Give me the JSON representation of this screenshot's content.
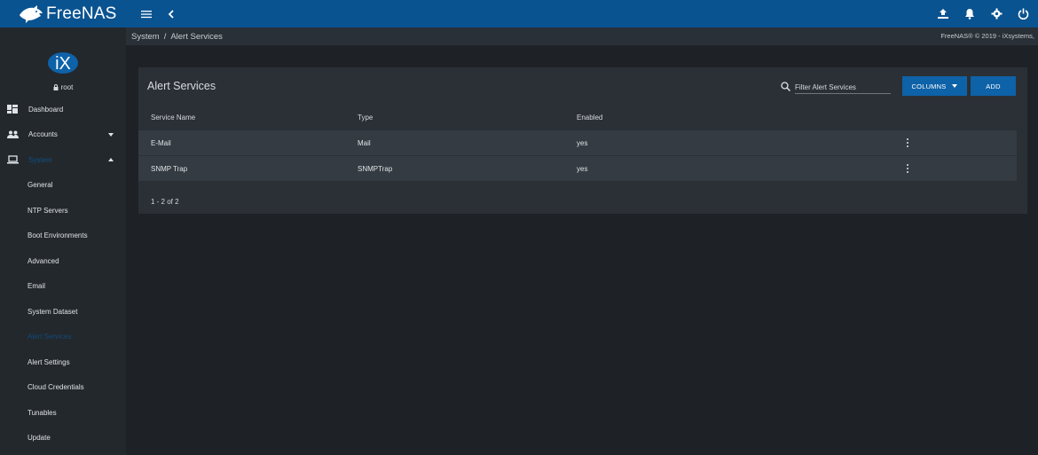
{
  "app": {
    "name": "FreeNAS"
  },
  "colors": {
    "topbar": "#0a5391",
    "accent": "#0e62a8",
    "sidebar": "#23282d",
    "card": "#2b3036"
  },
  "topbar": {
    "icons": [
      "menu-icon",
      "back-chevron-icon",
      "dropbox-upload-icon",
      "bell-icon",
      "gear-icon",
      "power-icon"
    ]
  },
  "sidebar": {
    "user": "root",
    "items": [
      {
        "label": "Dashboard",
        "icon": "dashboard-icon"
      },
      {
        "label": "Accounts",
        "icon": "people-icon",
        "expandable": true
      },
      {
        "label": "System",
        "icon": "laptop-icon",
        "expanded": true
      }
    ],
    "subitems": [
      {
        "label": "General"
      },
      {
        "label": "NTP Servers"
      },
      {
        "label": "Boot Environments"
      },
      {
        "label": "Advanced"
      },
      {
        "label": "Email"
      },
      {
        "label": "System Dataset"
      },
      {
        "label": "Alert Services",
        "active": true
      },
      {
        "label": "Alert Settings"
      },
      {
        "label": "Cloud Credentials"
      },
      {
        "label": "Tunables"
      },
      {
        "label": "Update"
      }
    ]
  },
  "breadcrumb": {
    "parent": "System",
    "separator": "/",
    "current": "Alert Services"
  },
  "copyright": "FreeNAS® © 2019 - iXsystems,",
  "card": {
    "title": "Alert Services",
    "filter_placeholder": "Filter Alert Services",
    "columns_label": "COLUMNS",
    "add_label": "ADD",
    "headers": {
      "name": "Service Name",
      "type": "Type",
      "enabled": "Enabled"
    },
    "rows": [
      {
        "name": "E-Mail",
        "type": "Mail",
        "enabled": "yes"
      },
      {
        "name": "SNMP Trap",
        "type": "SNMPTrap",
        "enabled": "yes"
      }
    ],
    "paginator": "1 - 2 of 2"
  }
}
